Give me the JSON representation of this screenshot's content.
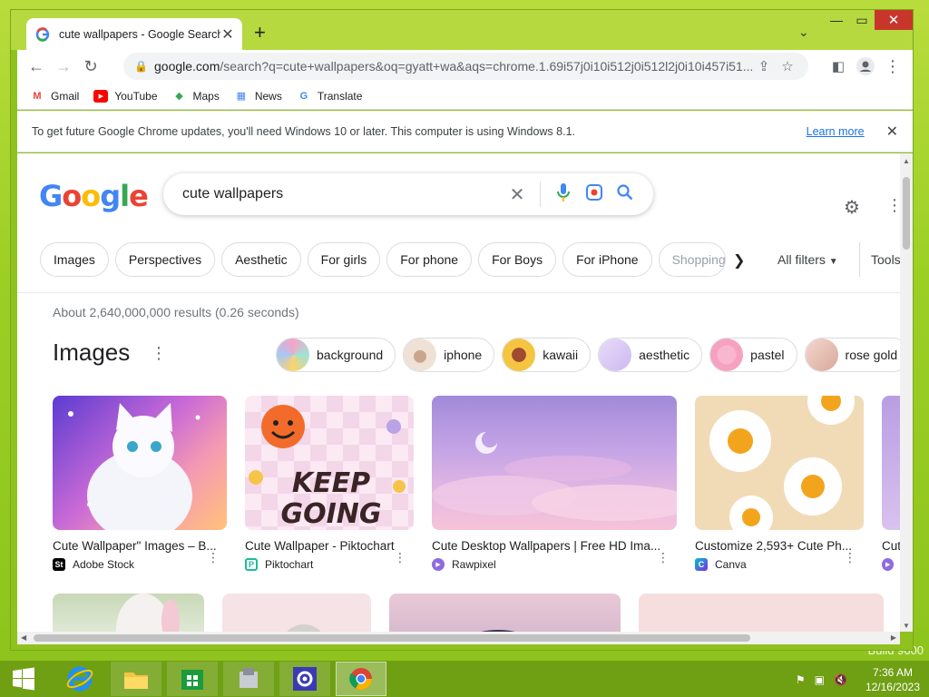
{
  "desktop": {
    "watermark": "Build 9600"
  },
  "window": {
    "tab_title": "cute wallpapers - Google Search",
    "url_domain": "google.com",
    "url_rest": "/search?q=cute+wallpapers&oq=gyatt+wa&aqs=chrome.1.69i57j0i10i512j0i512l2j0i10i457i51...",
    "bookmarks": [
      "Gmail",
      "YouTube",
      "Maps",
      "News",
      "Translate"
    ],
    "infobar_message": "To get future Google Chrome updates, you'll need Windows 10 or later. This computer is using Windows 8.1.",
    "infobar_link": "Learn more"
  },
  "search": {
    "logo": "Google",
    "query": "cute wallpapers",
    "filter_chips": [
      "Images",
      "Perspectives",
      "Aesthetic",
      "For girls",
      "For phone",
      "For Boys",
      "For iPhone",
      "Shopping"
    ],
    "all_filters": "All filters",
    "tools": "Tools",
    "results_count": "About 2,640,000,000 results (0.26 seconds)",
    "images_heading": "Images",
    "related": [
      "background",
      "iphone",
      "kawaii",
      "aesthetic",
      "pastel",
      "rose gold"
    ]
  },
  "image_results": [
    {
      "caption": "Cute Wallpaper\" Images – B...",
      "source": "Adobe Stock"
    },
    {
      "caption": "Cute Wallpaper - Piktochart",
      "source": "Piktochart",
      "overlay_text": "KEEP GOING"
    },
    {
      "caption": "Cute Desktop Wallpapers | Free HD Ima...",
      "source": "Rawpixel"
    },
    {
      "caption": "Customize 2,593+ Cute Ph...",
      "source": "Canva"
    },
    {
      "caption": "Cute",
      "source": "R"
    }
  ],
  "taskbar": {
    "time": "7:36 AM",
    "date": "12/16/2023"
  },
  "colors": {
    "accent": "#1a73e8",
    "desktop": "#9ccf24",
    "taskbar": "#6f9f13"
  }
}
